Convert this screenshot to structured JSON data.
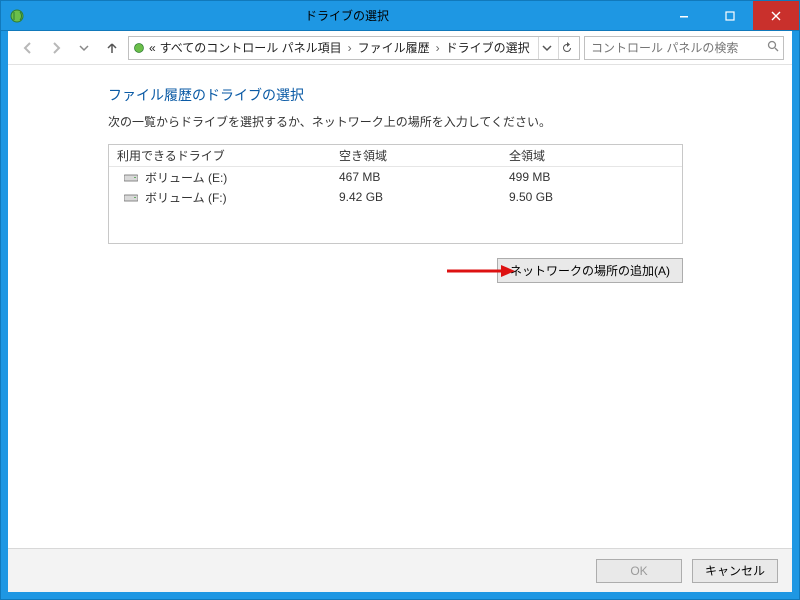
{
  "window": {
    "title": "ドライブの選択"
  },
  "nav": {
    "breadcrumb_prefix": "«",
    "crumbs": [
      "すべてのコントロール パネル項目",
      "ファイル履歴",
      "ドライブの選択"
    ],
    "search_placeholder": "コントロール パネルの検索"
  },
  "main": {
    "heading": "ファイル履歴のドライブの選択",
    "instruction": "次の一覧からドライブを選択するか、ネットワーク上の場所を入力してください。",
    "table": {
      "headers": {
        "name": "利用できるドライブ",
        "free": "空き領域",
        "total": "全領域"
      },
      "rows": [
        {
          "name": "ボリューム (E:)",
          "free": "467 MB",
          "total": "499 MB"
        },
        {
          "name": "ボリューム (F:)",
          "free": "9.42 GB",
          "total": "9.50 GB"
        }
      ]
    },
    "add_network_button": "ネットワークの場所の追加(A)"
  },
  "footer": {
    "ok": "OK",
    "cancel": "キャンセル"
  }
}
